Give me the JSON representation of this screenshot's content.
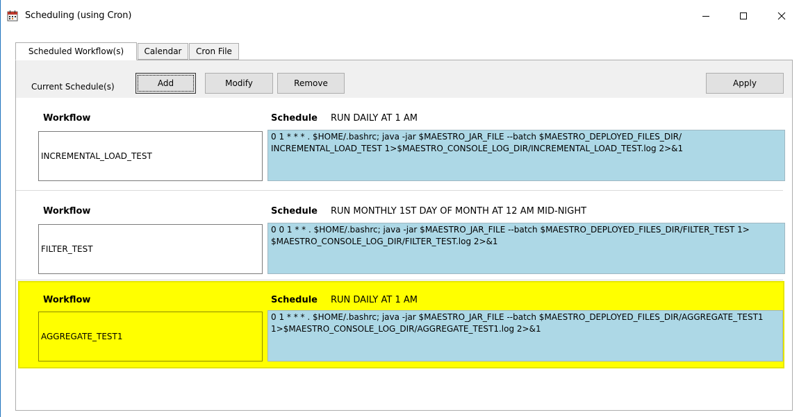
{
  "window": {
    "title": "Scheduling (using Cron)",
    "icon": "calendar-icon",
    "controls": [
      "minimize-icon",
      "maximize-icon",
      "close-icon"
    ]
  },
  "tabs": [
    {
      "label": "Scheduled Workflow(s)",
      "active": true
    },
    {
      "label": "Calendar",
      "active": false
    },
    {
      "label": "Cron File",
      "active": false
    }
  ],
  "toolbar": {
    "label": "Current Schedule(s)",
    "add_label": "Add",
    "modify_label": "Modify",
    "remove_label": "Remove",
    "apply_label": "Apply"
  },
  "schedules": [
    {
      "workflow_label": "Workflow",
      "schedule_label": "Schedule",
      "schedule": "RUN DAILY AT 1 AM",
      "workflow": "INCREMENTAL_LOAD_TEST",
      "command": "0 1 * * * . $HOME/.bashrc; java -jar $MAESTRO_JAR_FILE --batch $MAESTRO_DEPLOYED_FILES_DIR/\nINCREMENTAL_LOAD_TEST 1>$MAESTRO_CONSOLE_LOG_DIR/INCREMENTAL_LOAD_TEST.log 2>&1",
      "selected": false
    },
    {
      "workflow_label": "Workflow",
      "schedule_label": "Schedule",
      "schedule": "RUN MONTHLY 1ST DAY OF MONTH AT 12 AM MID-NIGHT",
      "workflow": "FILTER_TEST",
      "command": "0 0 1 * * . $HOME/.bashrc; java -jar $MAESTRO_JAR_FILE --batch $MAESTRO_DEPLOYED_FILES_DIR/FILTER_TEST 1>\n$MAESTRO_CONSOLE_LOG_DIR/FILTER_TEST.log 2>&1",
      "selected": false
    },
    {
      "workflow_label": "Workflow",
      "schedule_label": "Schedule",
      "schedule": "RUN DAILY AT 1 AM",
      "workflow": "AGGREGATE_TEST1",
      "command": "0 1 * * * . $HOME/.bashrc; java -jar $MAESTRO_JAR_FILE --batch $MAESTRO_DEPLOYED_FILES_DIR/AGGREGATE_TEST1\n1>$MAESTRO_CONSOLE_LOG_DIR/AGGREGATE_TEST1.log 2>&1",
      "selected": true
    }
  ],
  "colors": {
    "selected_row": "#ffff00",
    "command_background": "#add8e6",
    "toolbar_background": "#f0f0f0"
  }
}
